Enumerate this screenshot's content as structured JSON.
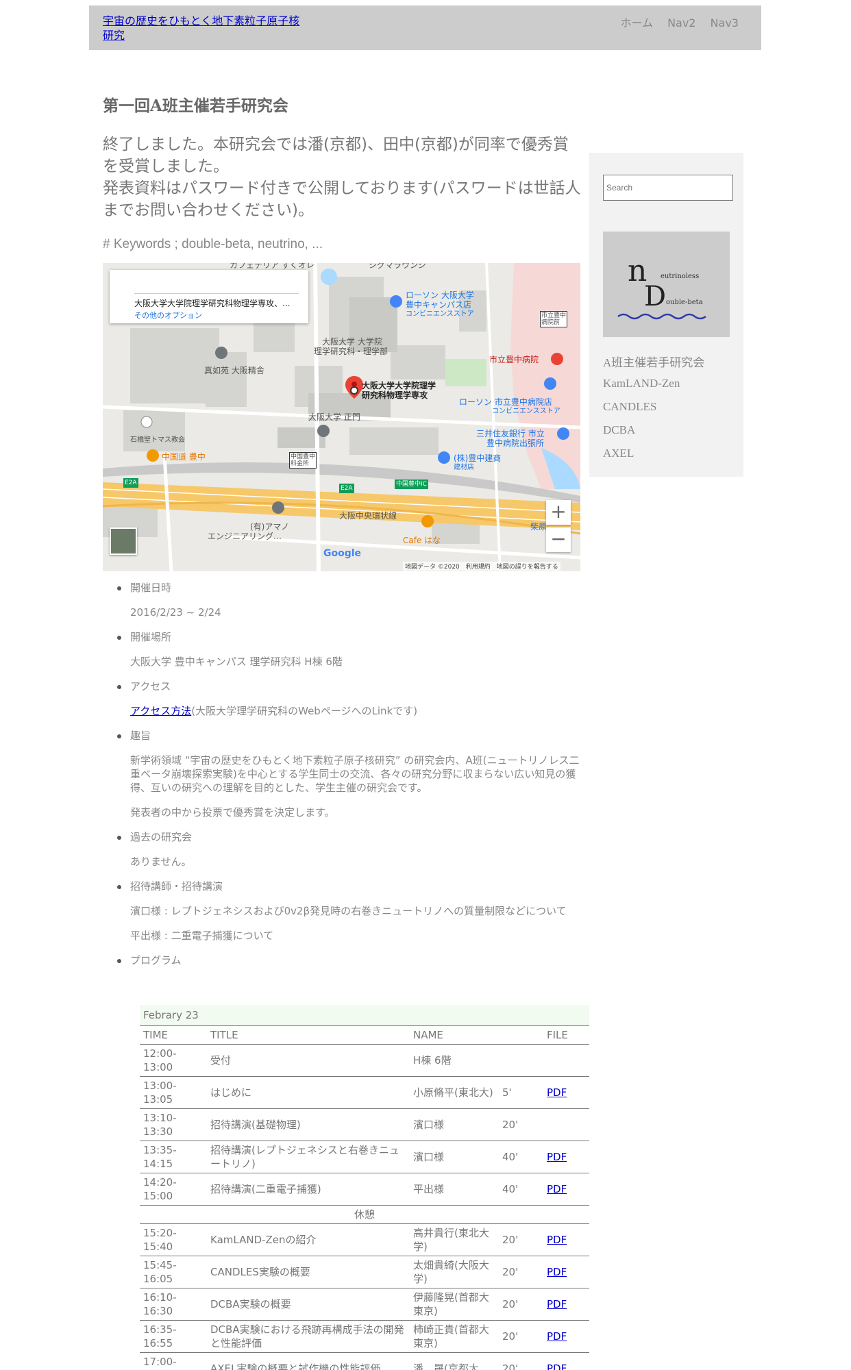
{
  "header": {
    "site_title": "宇宙の歴史をひもとく地下素粒子原子核研究",
    "nav": [
      "ホーム",
      "Nav2",
      "Nav3"
    ]
  },
  "main": {
    "title": "第一回A班主催若手研究会",
    "lead1": "終了しました。本研究会では潘(京都)、田中(京都)が同率で優秀賞を受賞しました。",
    "lead2": "発表資料はパスワード付きで公開しております(パスワードは世話人までお問い合わせください)。",
    "keywords": "# Keywords ; double-beta, neutrino, ..."
  },
  "map": {
    "destination": "大阪大学大学院理学研究科物理学専攻、...",
    "options_link": "その他のオプション",
    "pin_label_1": "大阪大学大学院理学",
    "pin_label_2": "研究科物理学専攻",
    "labels": {
      "sigma": "シグマラウンジ",
      "lawson1": "ローソン 大阪大学",
      "lawson1b": "豊中キャンパス店",
      "conv1": "コンビニエンスストア",
      "hospital_sign": "市立豊中",
      "hospital_sign2": "病院前",
      "sci": "大阪大学 大学院",
      "sci2": "理学研究科・理学部",
      "hospital": "市立豊中病院",
      "shinnyo": "真如苑 大阪精舎",
      "lawson2": "ローソン 市立豊中病院店",
      "conv2": "コンビニエンスストア",
      "gate": "大阪大学 正門",
      "smbc": "三井住友銀行 市立",
      "smbc2": "豊中病院出張所",
      "church": "石橋聖トマス教会",
      "hwy": "中国道 豊中",
      "toll": "中国豊中",
      "toll2": "料金所",
      "kenchiku": "(株)豊中建商",
      "kenchiku2": "建材店",
      "e2a": "E2A",
      "ic": "中国豊中IC",
      "ring": "大阪中央環状線",
      "amano": "(有)アマノ",
      "amano2": "エンジニアリング…",
      "cafe": "Cafe はな",
      "shiba": "柴原",
      "top": "カフェテリア すくオレ"
    },
    "google": "Google",
    "footer": "地図データ ©2020　利用規約　地図の誤りを報告する",
    "zoom_in": "+",
    "zoom_out": "−"
  },
  "info": {
    "date_label": "開催日時",
    "date_value": "2016/2/23 ~ 2/24",
    "venue_label": "開催場所",
    "venue_value": "大阪大学 豊中キャンパス 理学研究科 H棟 6階",
    "access_label": "アクセス",
    "access_link": "アクセス方法",
    "access_note": "(大阪大学理学研究科のWebページへのLinkです)",
    "purpose_label": "趣旨",
    "purpose_text": "新学術領域 “宇宙の歴史をひもとく地下素粒子原子核研究” の研究会内、A班(ニュートリノレス二重ベータ崩壊探索実験)を中心とする学生同士の交流、各々の研究分野に収まらない広い知見の獲得、互いの研究への理解を目的とした、学生主催の研究会です。",
    "purpose_text2": "発表者の中から投票で優秀賞を決定します。",
    "past_label": "過去の研究会",
    "past_value": "ありません。",
    "invited_label": "招待講師・招待講演",
    "invited_1": "濱口様 : レプトジェネシスおよび0v2β発見時の右巻きニュートリノへの質量制限などについて",
    "invited_2": "平出様 : 二重電子捕獲について",
    "program_label": "プログラム"
  },
  "program": {
    "day": "Febrary 23",
    "headers": [
      "TIME",
      "TITLE",
      "NAME",
      "",
      "FILE"
    ],
    "rows": [
      {
        "time": "12:00-13:00",
        "title": "受付",
        "name": "H棟 6階",
        "dur": "",
        "file": ""
      },
      {
        "time": "13:00-13:05",
        "title": "はじめに",
        "name": "小原脩平(東北大)",
        "dur": "5'",
        "file": "PDF"
      },
      {
        "time": "13:10-13:30",
        "title": "招待講演(基礎物理)",
        "name": "濱口様",
        "dur": "20'",
        "file": ""
      },
      {
        "time": "13:35-14:15",
        "title": "招待講演(レプトジェネシスと右巻きニュートリノ)",
        "name": "濱口様",
        "dur": "40'",
        "file": "PDF"
      },
      {
        "time": "14:20-15:00",
        "title": "招待講演(二重電子捕獲)",
        "name": "平出様",
        "dur": "40'",
        "file": "PDF"
      },
      {
        "time": "",
        "title": "休憩",
        "name": "",
        "dur": "",
        "file": "",
        "break": true
      },
      {
        "time": "15:20-15:40",
        "title": "KamLAND-Zenの紹介",
        "name": "高井貴行(東北大学)",
        "dur": "20'",
        "file": "PDF"
      },
      {
        "time": "15:45-16:05",
        "title": "CANDLES実験の概要",
        "name": "太畑貴綺(大阪大学)",
        "dur": "20'",
        "file": "PDF"
      },
      {
        "time": "16:10-16:30",
        "title": "DCBA実験の概要",
        "name": "伊藤隆晃(首都大東京)",
        "dur": "20'",
        "file": "PDF"
      },
      {
        "time": "16:35-16:55",
        "title": "DCBA実験における飛跡再構成手法の開発と性能評価",
        "name": "柿崎正貴(首都大東京)",
        "dur": "20'",
        "file": "PDF"
      },
      {
        "time": "17:00-17:20",
        "title": "AXEL実験の概要と試作機の性能評価",
        "name": "潘　晟(京都大",
        "dur": "20'",
        "file": "PDF"
      }
    ]
  },
  "sidebar": {
    "search_placeholder": "Search",
    "logo_line1": "eutrinoless",
    "logo_line2": "ouble-beta",
    "links": [
      "A班主催若手研究会",
      "KamLAND-Zen",
      "CANDLES",
      "DCBA",
      "AXEL"
    ]
  },
  "colors": {
    "header_bg": "#cccccc",
    "link": "#0000cc",
    "sidebar_bg": "#f2f2f2",
    "table_day_bg": "#f2fbef"
  }
}
